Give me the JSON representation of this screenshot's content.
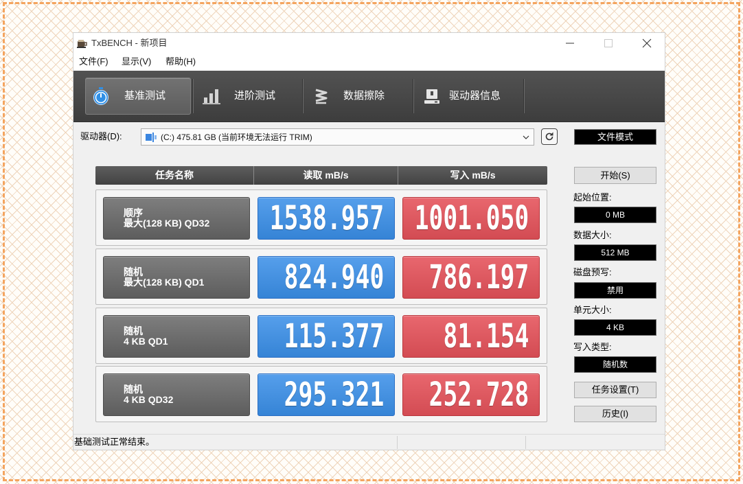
{
  "window": {
    "title": "TxBENCH - 新项目"
  },
  "menu": {
    "items": [
      {
        "label": "文件(F)"
      },
      {
        "label": "显示(V)"
      },
      {
        "label": "帮助(H)"
      }
    ]
  },
  "toolbar": {
    "tabs": [
      {
        "label": "基准测试",
        "icon": "stopwatch-icon",
        "active": true
      },
      {
        "label": "进阶测试",
        "icon": "bar-chart-icon",
        "active": false
      },
      {
        "label": "数据擦除",
        "icon": "erase-wave-icon",
        "active": false
      },
      {
        "label": "驱动器信息",
        "icon": "drive-info-icon",
        "active": false
      }
    ]
  },
  "drive": {
    "label": "驱动器(D):",
    "selected": "(C:)  475.81 GB (当前环境无法运行 TRIM)",
    "mode_button": "文件模式"
  },
  "table": {
    "headers": [
      "任务名称",
      "读取 mB/s",
      "写入 mB/s"
    ],
    "rows": [
      {
        "name": "顺序",
        "detail": "最大(128 KB) QD32",
        "read": "1538.957",
        "write": "1001.050"
      },
      {
        "name": "随机",
        "detail": "最大(128 KB) QD1",
        "read": "824.940",
        "write": "786.197"
      },
      {
        "name": "随机",
        "detail": "4 KB QD1",
        "read": "115.377",
        "write": "81.154"
      },
      {
        "name": "随机",
        "detail": "4 KB QD32",
        "read": "295.321",
        "write": "252.728"
      }
    ]
  },
  "settings": {
    "start_button": "开始(S)",
    "fields": [
      {
        "label": "起始位置:",
        "value": "0 MB"
      },
      {
        "label": "数据大小:",
        "value": "512 MB"
      },
      {
        "label": "磁盘预写:",
        "value": "禁用"
      },
      {
        "label": "单元大小:",
        "value": "4 KB"
      },
      {
        "label": "写入类型:",
        "value": "随机数"
      }
    ],
    "task_settings_button": "任务设置(T)",
    "history_button": "历史(I)"
  },
  "status_bar": {
    "text": "基础测试正常结束。"
  },
  "colors": {
    "read_value": "#3a8fe8",
    "write_value": "#e5525a",
    "toolbar": "#4a4a4a",
    "frame_border": "#f4a45e",
    "stopwatch": "#2f8fe6"
  }
}
